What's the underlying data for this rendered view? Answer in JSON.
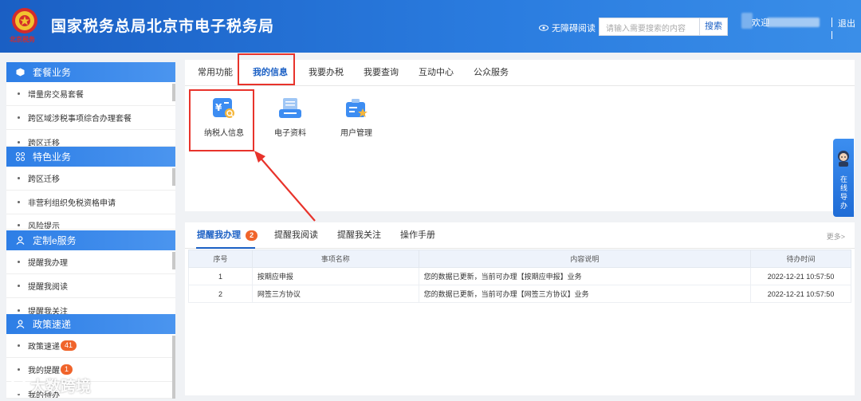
{
  "header": {
    "title": "国家税务总局北京市电子税务局",
    "emblem_caption": "北京税务",
    "accessibility": "无障碍阅读",
    "search_placeholder": "请输入需要搜索的内容",
    "search_button": "搜索",
    "welcome": "欢迎",
    "logout": "退出"
  },
  "sidebar": {
    "sections": [
      {
        "title": "套餐业务",
        "icon": "cube-icon",
        "items": [
          "增量房交易套餐",
          "跨区域涉税事项综合办理套餐",
          "跨区迁移"
        ]
      },
      {
        "title": "特色业务",
        "icon": "grid-icon",
        "items": [
          "跨区迁移",
          "非营利组织免税资格申请",
          "风险提示"
        ]
      },
      {
        "title": "定制e服务",
        "icon": "user-icon",
        "items": [
          "提醒我办理",
          "提醒我阅读",
          "提醒我关注"
        ]
      },
      {
        "title": "政策速递",
        "icon": "user-icon",
        "items": [
          "政策速递",
          "我的提醒",
          "我的待办"
        ],
        "badges": [
          "41",
          "1",
          ""
        ]
      }
    ]
  },
  "top_tabs": [
    "常用功能",
    "我的信息",
    "我要办税",
    "我要查询",
    "互动中心",
    "公众服务"
  ],
  "functions": [
    {
      "label": "纳税人信息",
      "icon": "taxpayer-info-icon"
    },
    {
      "label": "电子资料",
      "icon": "electronic-data-icon"
    },
    {
      "label": "用户管理",
      "icon": "user-management-icon"
    }
  ],
  "bottom_tabs": {
    "items": [
      "提醒我办理",
      "提醒我阅读",
      "提醒我关注",
      "操作手册"
    ],
    "badge": "2",
    "more": "更多>"
  },
  "table": {
    "headers": [
      "序号",
      "事项名称",
      "内容说明",
      "待办时间"
    ],
    "rows": [
      [
        "1",
        "按期应申报",
        "您的数据已更新，当前可办理【按期应申报】业务",
        "2022-12-21 10:57:50"
      ],
      [
        "2",
        "网签三方协议",
        "您的数据已更新，当前可办理【网签三方协议】业务",
        "2022-12-21 10:57:50"
      ]
    ]
  },
  "float_service": "在线导办",
  "watermark": "大数跨境",
  "colors": {
    "brand_blue": "#1a5fc4",
    "highlight_red": "#e8332b",
    "badge_orange": "#f0642b"
  }
}
